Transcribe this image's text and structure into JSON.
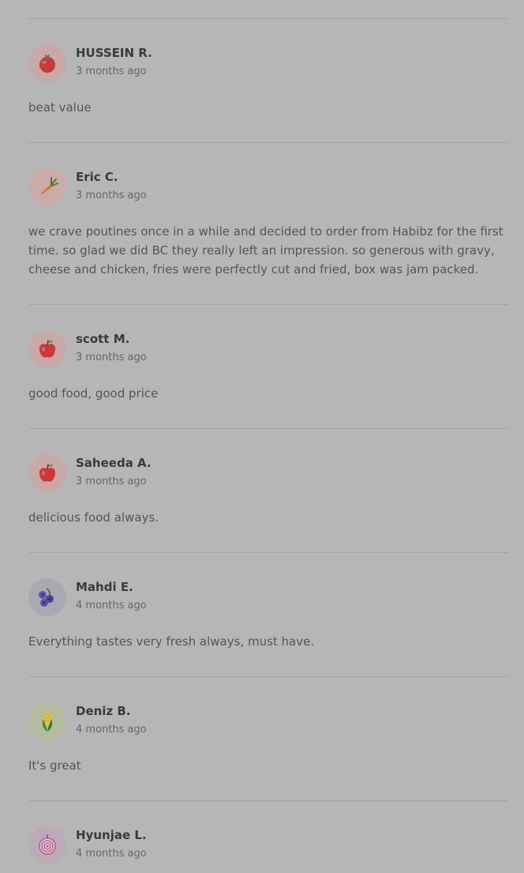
{
  "reviews": [
    {
      "name": "HUSSEIN R.",
      "time": "3 months ago",
      "text": "beat value",
      "avatar_icon": "tomato-icon",
      "avatar_bg": "#c9a8a8"
    },
    {
      "name": "Eric C.",
      "time": "3 months ago",
      "text": "we crave poutines once in a while and decided to order from Habibz for the first time. so glad we did BC they really left an impression. so generous with gravy, cheese and chicken, fries were perfectly cut and fried, box was jam packed.",
      "avatar_icon": "carrot-icon",
      "avatar_bg": "#c9aca8"
    },
    {
      "name": "scott M.",
      "time": "3 months ago",
      "text": "good food, good price",
      "avatar_icon": "apple-icon",
      "avatar_bg": "#c9a8a8"
    },
    {
      "name": "Saheeda A.",
      "time": "3 months ago",
      "text": "delicious food always.",
      "avatar_icon": "apple-icon",
      "avatar_bg": "#c9a8a8"
    },
    {
      "name": "Mahdi E.",
      "time": "4 months ago",
      "text": "Everything tastes very fresh always, must have.",
      "avatar_icon": "blueberries-icon",
      "avatar_bg": "#a9a9b2"
    },
    {
      "name": "Deniz B.",
      "time": "4 months ago",
      "text": "It's great",
      "avatar_icon": "corn-icon",
      "avatar_bg": "#b4bca0"
    },
    {
      "name": "Hyunjae L.",
      "time": "4 months ago",
      "text": "",
      "avatar_icon": "onion-icon",
      "avatar_bg": "#bcaab6"
    }
  ]
}
